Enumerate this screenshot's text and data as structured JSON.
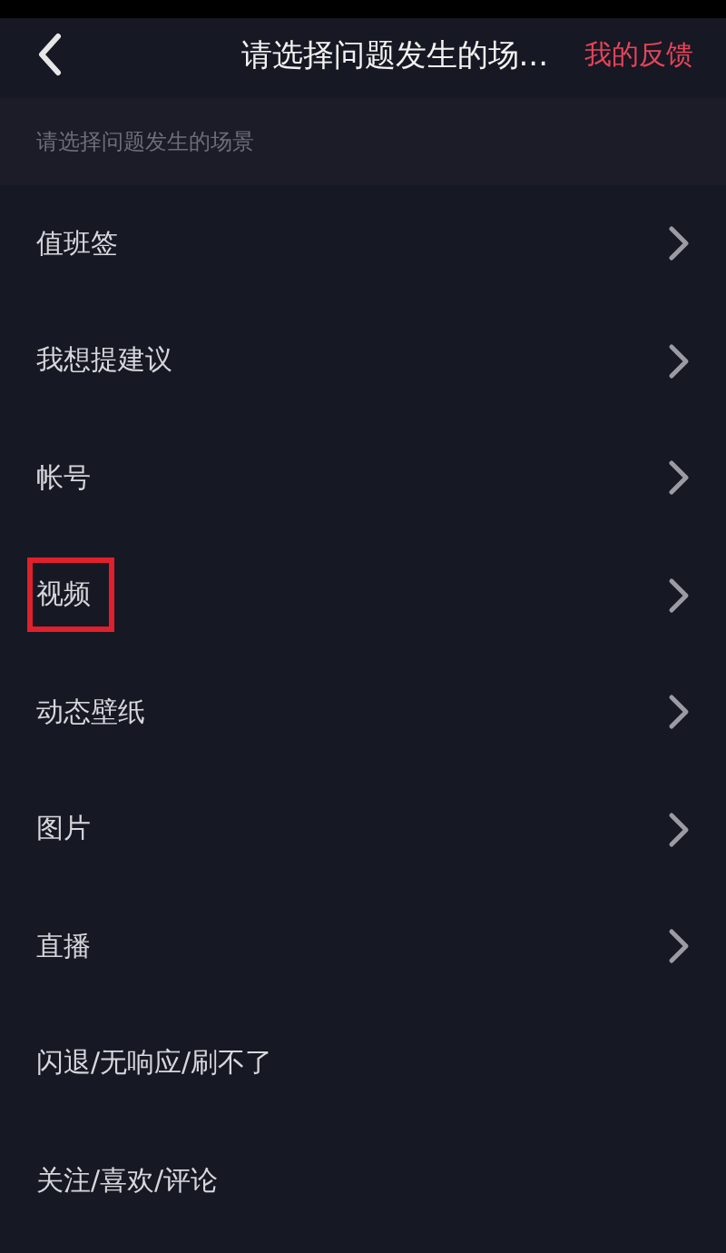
{
  "header": {
    "title": "请选择问题发生的场...",
    "action": "我的反馈"
  },
  "section_title": "请选择问题发生的场景",
  "items": [
    {
      "label": "值班签",
      "chevron": true,
      "highlighted": false
    },
    {
      "label": "我想提建议",
      "chevron": true,
      "highlighted": false
    },
    {
      "label": "帐号",
      "chevron": true,
      "highlighted": false
    },
    {
      "label": "视频",
      "chevron": true,
      "highlighted": true
    },
    {
      "label": "动态壁纸",
      "chevron": true,
      "highlighted": false
    },
    {
      "label": "图片",
      "chevron": true,
      "highlighted": false
    },
    {
      "label": "直播",
      "chevron": true,
      "highlighted": false
    },
    {
      "label": "闪退/无响应/刷不了",
      "chevron": false,
      "highlighted": false
    },
    {
      "label": "关注/喜欢/评论",
      "chevron": false,
      "highlighted": false
    }
  ]
}
